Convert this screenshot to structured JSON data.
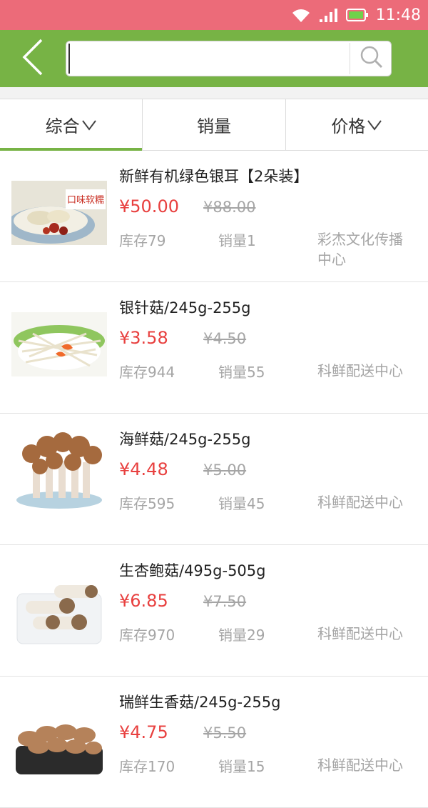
{
  "status_bar": {
    "time": "11:48",
    "accent": "#ec6b79",
    "icons": [
      "wifi-icon",
      "signal-icon",
      "battery-icon"
    ]
  },
  "header": {
    "back_icon": "back-chevron-icon",
    "search": {
      "value": "",
      "placeholder": ""
    },
    "search_icon": "search-icon",
    "color": "#77b345"
  },
  "tabs": [
    {
      "label": "综合",
      "has_chevron": true,
      "active": true
    },
    {
      "label": "销量",
      "has_chevron": false,
      "active": false
    },
    {
      "label": "价格",
      "has_chevron": true,
      "active": false
    }
  ],
  "products": [
    {
      "name": "新鲜有机绿色银耳【2朵装】",
      "price": "¥50.00",
      "old_price": "¥88.00",
      "stock": "库存79",
      "sales": "销量1",
      "shop": "彩杰文化传播中心",
      "image_badge": "口味软糯"
    },
    {
      "name": "银针菇/245g-255g",
      "price": "¥3.58",
      "old_price": "¥4.50",
      "stock": "库存944",
      "sales": "销量55",
      "shop": "科鲜配送中心"
    },
    {
      "name": "海鲜菇/245g-255g",
      "price": "¥4.48",
      "old_price": "¥5.00",
      "stock": "库存595",
      "sales": "销量45",
      "shop": "科鲜配送中心"
    },
    {
      "name": "生杏鲍菇/495g-505g",
      "price": "¥6.85",
      "old_price": "¥7.50",
      "stock": "库存970",
      "sales": "销量29",
      "shop": "科鲜配送中心"
    },
    {
      "name": "瑞鲜生香菇/245g-255g",
      "price": "¥4.75",
      "old_price": "¥5.50",
      "stock": "库存170",
      "sales": "销量15",
      "shop": "科鲜配送中心"
    }
  ]
}
